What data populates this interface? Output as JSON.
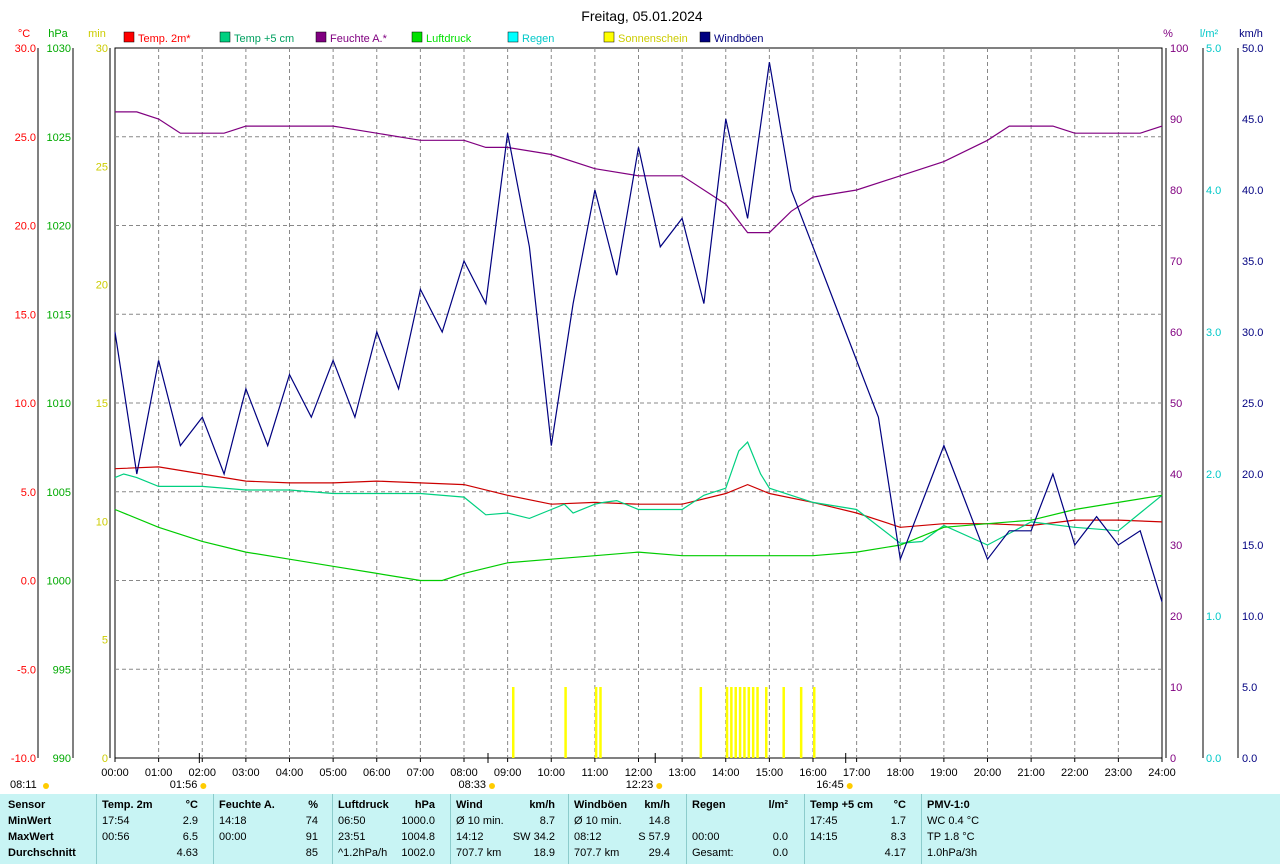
{
  "chart_data": {
    "type": "line",
    "title": "Freitag, 05.01.2024",
    "x_ticks": [
      "00:00",
      "01:00",
      "02:00",
      "03:00",
      "04:00",
      "05:00",
      "06:00",
      "07:00",
      "08:00",
      "09:00",
      "10:00",
      "11:00",
      "12:00",
      "13:00",
      "14:00",
      "15:00",
      "16:00",
      "17:00",
      "18:00",
      "19:00",
      "20:00",
      "21:00",
      "22:00",
      "23:00",
      "24:00"
    ],
    "x_range_hours": [
      0,
      24
    ],
    "grid": true,
    "axes": {
      "temp": {
        "unit": "°C",
        "min": -10,
        "max": 30,
        "ticks": [
          "30.0",
          "25.0",
          "20.0",
          "15.0",
          "10.0",
          "5.0",
          "0.0",
          "-5.0",
          "-10.0"
        ],
        "color": "#ff0000"
      },
      "pressure": {
        "unit": "hPa",
        "min": 990,
        "max": 1030,
        "ticks": [
          "1030",
          "1025",
          "1020",
          "1015",
          "1010",
          "1005",
          "1000",
          "995",
          "990"
        ],
        "color": "#00aa00"
      },
      "sunshine": {
        "unit": "min",
        "min": 0,
        "max": 30,
        "ticks": [
          "30",
          "25",
          "20",
          "15",
          "10",
          "5",
          "0"
        ],
        "color": "#cccc00"
      },
      "humidity": {
        "unit": "%",
        "min": 0,
        "max": 100,
        "ticks": [
          "100",
          "90",
          "80",
          "70",
          "60",
          "50",
          "40",
          "30",
          "20",
          "10",
          "0"
        ],
        "color": "#800080"
      },
      "rain": {
        "unit": "l/m²",
        "min": 0,
        "max": 5,
        "ticks": [
          "5.0",
          "4.0",
          "3.0",
          "2.0",
          "1.0",
          "0.0"
        ],
        "color": "#00c8c8"
      },
      "wind": {
        "unit": "km/h",
        "min": 0,
        "max": 50,
        "ticks": [
          "50.0",
          "45.0",
          "40.0",
          "35.0",
          "30.0",
          "25.0",
          "20.0",
          "15.0",
          "10.0",
          "5.0",
          "0.0"
        ],
        "color": "#000080"
      }
    },
    "legend": [
      {
        "name": "Temp. 2m*",
        "color": "#ff0000"
      },
      {
        "name": "Temp +5 cm",
        "color": "#00d080"
      },
      {
        "name": "Feuchte A.*",
        "color": "#800080"
      },
      {
        "name": "Luftdruck",
        "color": "#00e000"
      },
      {
        "name": "Regen",
        "color": "#00ffff"
      },
      {
        "name": "Sonnenschein",
        "color": "#ffff00"
      },
      {
        "name": "Windböen",
        "color": "#000080"
      }
    ],
    "series": [
      {
        "name": "Temp. 2m*",
        "axis": "temp",
        "color": "#cc0000",
        "x": [
          0,
          1,
          2,
          3,
          4,
          5,
          6,
          7,
          8,
          9,
          10,
          11,
          12,
          13,
          14,
          14.5,
          15,
          16,
          17,
          18,
          19,
          20,
          21,
          22,
          23,
          24
        ],
        "y": [
          6.3,
          6.4,
          6.0,
          5.6,
          5.5,
          5.5,
          5.6,
          5.5,
          5.4,
          4.8,
          4.3,
          4.4,
          4.3,
          4.3,
          4.9,
          5.4,
          4.9,
          4.4,
          3.8,
          3.0,
          3.2,
          3.2,
          3.1,
          3.4,
          3.4,
          3.3
        ]
      },
      {
        "name": "Temp +5 cm",
        "axis": "temp",
        "color": "#00d080",
        "x": [
          0,
          0.2,
          0.5,
          1,
          2,
          3,
          4,
          5,
          6,
          7,
          8,
          8.5,
          9,
          9.5,
          10,
          10.3,
          10.5,
          11,
          11.2,
          11.5,
          12,
          12.5,
          13,
          13.5,
          14,
          14.3,
          14.5,
          14.8,
          15,
          16,
          17,
          18,
          18.5,
          19,
          20,
          21,
          22,
          23,
          23.5,
          24
        ],
        "y": [
          5.8,
          6.0,
          5.8,
          5.3,
          5.3,
          5.1,
          5.1,
          4.9,
          4.9,
          4.9,
          4.7,
          3.7,
          3.8,
          3.5,
          4.0,
          4.3,
          3.8,
          4.3,
          4.4,
          4.5,
          4.0,
          4.0,
          4.0,
          4.8,
          5.2,
          7.3,
          7.8,
          6.0,
          5.2,
          4.4,
          4.0,
          2.1,
          2.2,
          3.1,
          2.0,
          3.3,
          3.0,
          2.8,
          3.8,
          4.8
        ]
      },
      {
        "name": "Feuchte A.*",
        "axis": "humidity",
        "color": "#800080",
        "x": [
          0,
          0.5,
          1,
          1.5,
          2,
          2.5,
          3,
          4,
          5,
          6,
          7,
          8,
          8.5,
          9,
          10,
          11,
          12,
          13,
          14,
          14.5,
          15,
          15.5,
          16,
          17,
          18,
          19,
          20,
          20.5,
          21,
          21.5,
          22,
          23,
          23.5,
          24
        ],
        "y": [
          91,
          91,
          90,
          88,
          88,
          88,
          89,
          89,
          89,
          88,
          87,
          87,
          86,
          86,
          85,
          83,
          82,
          82,
          78,
          74,
          74,
          77,
          79,
          80,
          82,
          84,
          87,
          89,
          89,
          89,
          88,
          88,
          88,
          89
        ]
      },
      {
        "name": "Luftdruck",
        "axis": "pressure",
        "color": "#00cc00",
        "x": [
          0,
          1,
          2,
          3,
          4,
          5,
          6,
          7,
          7.5,
          8,
          9,
          10,
          11,
          12,
          13,
          14,
          15,
          16,
          17,
          18,
          19,
          20,
          21,
          22,
          23,
          24
        ],
        "y": [
          1004.0,
          1003.0,
          1002.2,
          1001.6,
          1001.2,
          1000.8,
          1000.4,
          1000.0,
          1000.0,
          1000.4,
          1001.0,
          1001.2,
          1001.4,
          1001.6,
          1001.4,
          1001.4,
          1001.4,
          1001.4,
          1001.6,
          1002.0,
          1003.0,
          1003.2,
          1003.4,
          1004.0,
          1004.4,
          1004.8
        ]
      },
      {
        "name": "Windböen",
        "axis": "wind",
        "color": "#000080",
        "x": [
          0,
          0.5,
          1,
          1.5,
          2,
          2.5,
          3,
          3.5,
          4,
          4.5,
          5,
          5.5,
          6,
          6.5,
          7,
          7.5,
          8,
          8.5,
          9,
          9.5,
          10,
          10.5,
          11,
          11.5,
          12,
          12.5,
          13,
          13.5,
          14,
          14.5,
          15,
          15.5,
          16,
          16.5,
          17,
          17.5,
          18,
          18.5,
          19,
          19.5,
          20,
          20.5,
          21,
          21.5,
          22,
          22.5,
          23,
          23.5,
          24
        ],
        "y": [
          30,
          20,
          28,
          22,
          24,
          20,
          26,
          22,
          27,
          24,
          28,
          24,
          30,
          26,
          33,
          30,
          35,
          32,
          44,
          36,
          22,
          32,
          40,
          34,
          43,
          36,
          38,
          32,
          45,
          38,
          49,
          40,
          36,
          32,
          28,
          24,
          14,
          18,
          22,
          18,
          14,
          16,
          16,
          20,
          15,
          17,
          15,
          16,
          11
        ]
      }
    ],
    "sunshine_bars": {
      "axis": "sunshine",
      "x": [
        9.1,
        10.3,
        11.0,
        11.1,
        13.4,
        14.0,
        14.1,
        14.2,
        14.3,
        14.4,
        14.5,
        14.6,
        14.7,
        14.9,
        15.3,
        15.7,
        16.0
      ],
      "y": [
        3,
        3,
        3,
        3,
        3,
        3,
        3,
        3,
        3,
        3,
        3,
        3,
        3,
        3,
        3,
        3,
        3
      ]
    },
    "rain": {
      "total": 0.0
    }
  },
  "markers": {
    "sunrise": "08:33",
    "sunset": "16:45",
    "noon": "12:23",
    "moonrise": "01:56",
    "moonset": "08:11"
  },
  "stats": {
    "headers": [
      {
        "label": "Sensor",
        "unit": ""
      },
      {
        "label": "Temp. 2m",
        "unit": "°C"
      },
      {
        "label": "Feuchte A.",
        "unit": "%"
      },
      {
        "label": "Luftdruck",
        "unit": "hPa"
      },
      {
        "label": "Wind",
        "unit": "km/h"
      },
      {
        "label": "Windböen",
        "unit": "km/h"
      },
      {
        "label": "Regen",
        "unit": "l/m²"
      },
      {
        "label": "Temp +5 cm",
        "unit": "°C"
      },
      {
        "label": "PMV-1:0",
        "unit": ""
      }
    ],
    "rows": [
      {
        "label": "MinWert",
        "temp": [
          "17:54",
          "2.9"
        ],
        "hum": [
          "14:18",
          "74"
        ],
        "pres": [
          "06:50",
          "1000.0"
        ],
        "wind": [
          "Ø 10 min.",
          "8.7"
        ],
        "gust": [
          "Ø 10 min.",
          "14.8"
        ],
        "rain": [
          "",
          ""
        ],
        "t5": [
          "17:45",
          "1.7"
        ],
        "pmv": "WC 0.4 °C"
      },
      {
        "label": "MaxWert",
        "temp": [
          "00:56",
          "6.5"
        ],
        "hum": [
          "00:00",
          "91"
        ],
        "pres": [
          "23:51",
          "1004.8"
        ],
        "wind": [
          "14:12",
          "SW 34.2"
        ],
        "gust": [
          "08:12",
          "S 57.9"
        ],
        "rain": [
          "00:00",
          "0.0"
        ],
        "t5": [
          "14:15",
          "8.3"
        ],
        "pmv": "TP 1.8 °C"
      },
      {
        "label": "Durchschnitt",
        "temp": [
          "",
          "4.63"
        ],
        "hum": [
          "",
          "85"
        ],
        "pres": [
          "^1.2hPa/h",
          "1002.0"
        ],
        "wind": [
          "707.7 km",
          "18.9"
        ],
        "gust": [
          "707.7 km",
          "29.4"
        ],
        "rain": [
          "Gesamt:",
          "0.0"
        ],
        "t5": [
          "",
          "4.17"
        ],
        "pmv": "1.0hPa/3h"
      }
    ]
  }
}
